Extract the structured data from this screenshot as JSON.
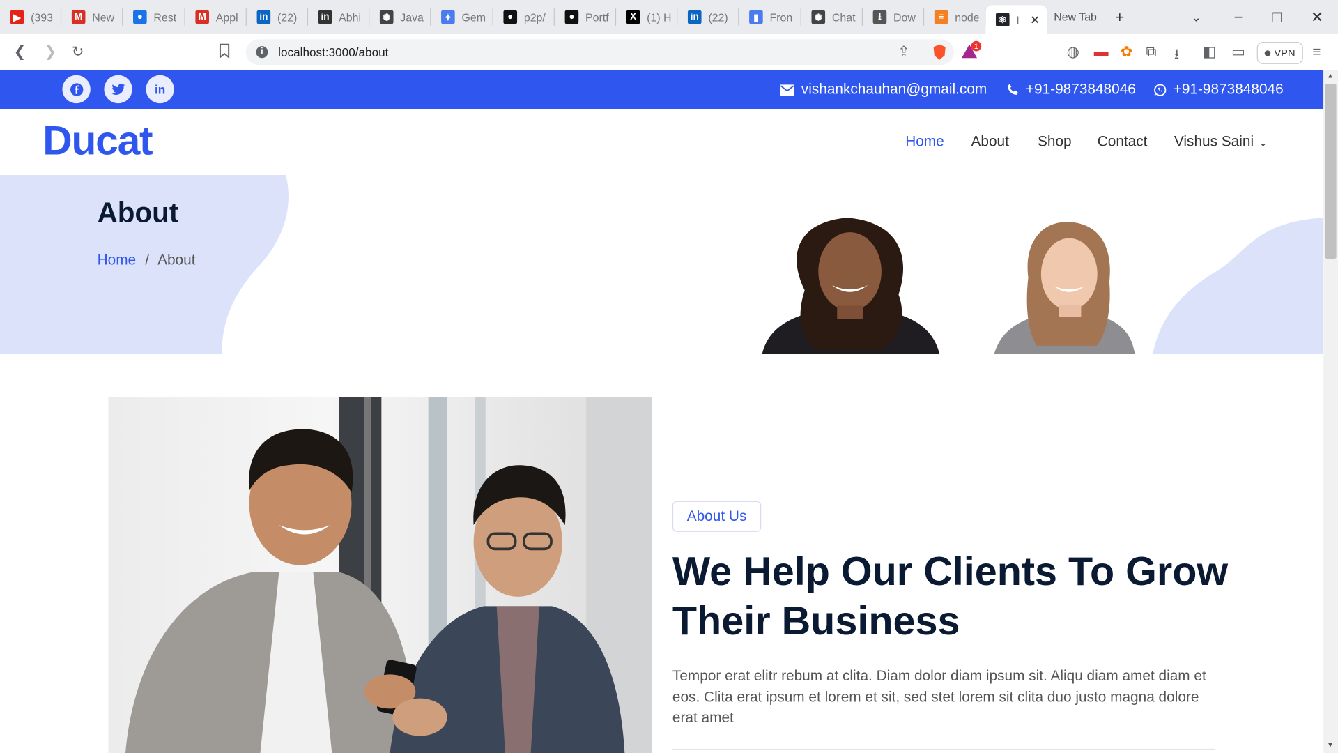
{
  "browser": {
    "tabs": [
      {
        "label": "(393",
        "icon": "youtube-icon",
        "color": "#e62117",
        "glyph": "▶"
      },
      {
        "label": "New",
        "icon": "gmail-icon",
        "color": "#d93025",
        "glyph": "M"
      },
      {
        "label": "Rest",
        "icon": "contacts-icon",
        "color": "#1a73e8",
        "glyph": "●"
      },
      {
        "label": "Appl",
        "icon": "gmail-icon",
        "color": "#d93025",
        "glyph": "M"
      },
      {
        "label": "(22)",
        "icon": "linkedin-icon",
        "color": "#0a66c2",
        "glyph": "in"
      },
      {
        "label": "Abhi",
        "icon": "linkedin-icon",
        "color": "#333333",
        "glyph": "in"
      },
      {
        "label": "Javas",
        "icon": "openai-icon",
        "color": "#444444",
        "glyph": "✺"
      },
      {
        "label": "Gem",
        "icon": "gemini-icon",
        "color": "#4a7cf0",
        "glyph": "✦"
      },
      {
        "label": "p2p/",
        "icon": "github-icon",
        "color": "#111111",
        "glyph": "●"
      },
      {
        "label": "Portf",
        "icon": "github-icon",
        "color": "#111111",
        "glyph": "●"
      },
      {
        "label": "(1) H",
        "icon": "x-icon",
        "color": "#000000",
        "glyph": "X"
      },
      {
        "label": "(22)",
        "icon": "linkedin-icon",
        "color": "#0a66c2",
        "glyph": "in"
      },
      {
        "label": "Fron",
        "icon": "bookmark-icon",
        "color": "#4a7cf0",
        "glyph": "▮"
      },
      {
        "label": "Chat",
        "icon": "openai-icon",
        "color": "#444444",
        "glyph": "✺"
      },
      {
        "label": "Dow",
        "icon": "download-icon",
        "color": "#555555",
        "glyph": "⭳"
      },
      {
        "label": "node",
        "icon": "stackoverflow-icon",
        "color": "#f48024",
        "glyph": "≡"
      },
      {
        "label": "I",
        "icon": "react-icon",
        "color": "#20232a",
        "glyph": "⚛",
        "active": true
      }
    ],
    "newtab_label": "New Tab",
    "url": "localhost:3000/about",
    "vpn_label": "VPN",
    "notif_count": "1"
  },
  "topbar": {
    "social": [
      {
        "name": "facebook",
        "glyph": "f"
      },
      {
        "name": "twitter",
        "glyph": "t"
      },
      {
        "name": "linkedin",
        "glyph": "in"
      }
    ],
    "email": "vishankchauhan@gmail.com",
    "phone": "+91-9873848046",
    "whatsapp": "+91-9873848046"
  },
  "nav": {
    "brand": "Ducat",
    "items": [
      "Home",
      "About",
      "Shop",
      "Contact"
    ],
    "user": "Vishus Saini"
  },
  "hero": {
    "title": "About",
    "crumb_home": "Home",
    "crumb_sep": "/",
    "crumb_current": "About"
  },
  "about": {
    "badge": "About Us",
    "headline": "We Help Our Clients To Grow Their Business",
    "paragraph": "Tempor erat elitr rebum at clita. Diam dolor diam ipsum sit. Aliqu diam amet diam et eos. Clita erat ipsum et lorem et sit, sed stet lorem sit clita duo justo magna dolore erat amet"
  },
  "colors": {
    "primary": "#2f57ef",
    "heading": "#0a1a33",
    "blob": "#dde2fb"
  }
}
